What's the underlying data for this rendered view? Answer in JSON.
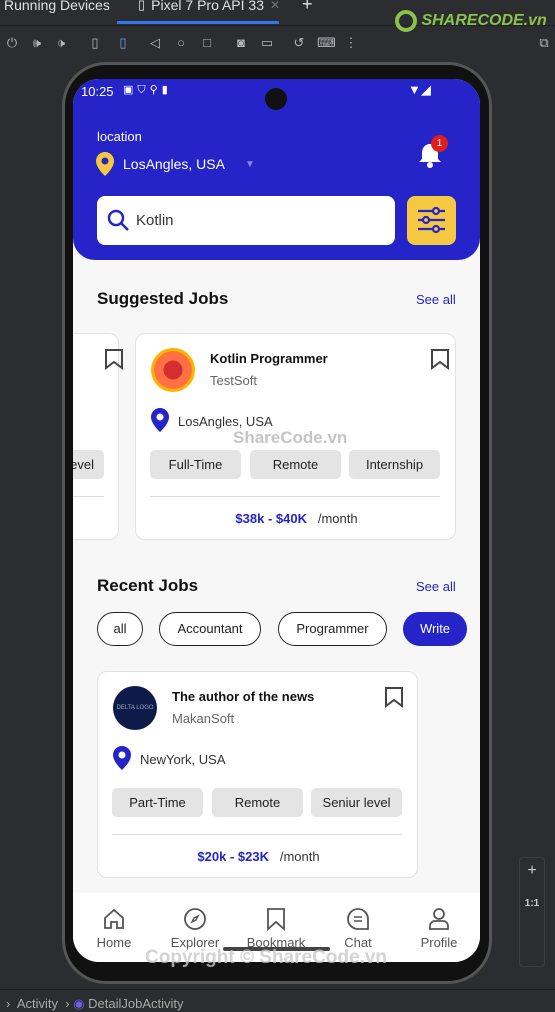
{
  "ide": {
    "panel_title": "Running Devices",
    "device_tab": "Pixel 7 Pro API 33",
    "breadcrumb": [
      "Activity",
      "DetailJobActivity"
    ],
    "zoom_label": "1:1"
  },
  "status": {
    "time": "10:25"
  },
  "header": {
    "location_label": "location",
    "location_value": "LosAngles, USA",
    "notification_count": "1",
    "search_value": "Kotlin"
  },
  "suggested": {
    "title": "Suggested Jobs",
    "see_all": "See all",
    "partial_card": {
      "tag": "evel"
    },
    "card": {
      "title": "Kotlin Programmer",
      "company": "TestSoft",
      "location": "LosAngles, USA",
      "tags": [
        "Full-Time",
        "Remote",
        "Internship"
      ],
      "salary": "$38k - $40K",
      "period": "/month"
    }
  },
  "recent": {
    "title": "Recent Jobs",
    "see_all": "See all",
    "chips": [
      "all",
      "Accountant",
      "Programmer",
      "Write"
    ],
    "selected_chip": "Write",
    "card": {
      "title": "The author of the news",
      "company": "MakanSoft",
      "logo_text": "DELTA LOGO",
      "location": "NewYork, USA",
      "tags": [
        "Part-Time",
        "Remote",
        "Seniur level"
      ],
      "salary": "$20k - $23K",
      "period": "/month"
    }
  },
  "nav": [
    "Home",
    "Explorer",
    "Bookmark",
    "Chat",
    "Profile"
  ],
  "watermark": {
    "top": "ShareCode.vn",
    "bottom": "Copyright © ShareCode.vn",
    "logo": "SHARECODE.vn"
  },
  "colors": {
    "primary": "#2424c8",
    "accent": "#f5c842",
    "badge": "#e11d1d"
  }
}
